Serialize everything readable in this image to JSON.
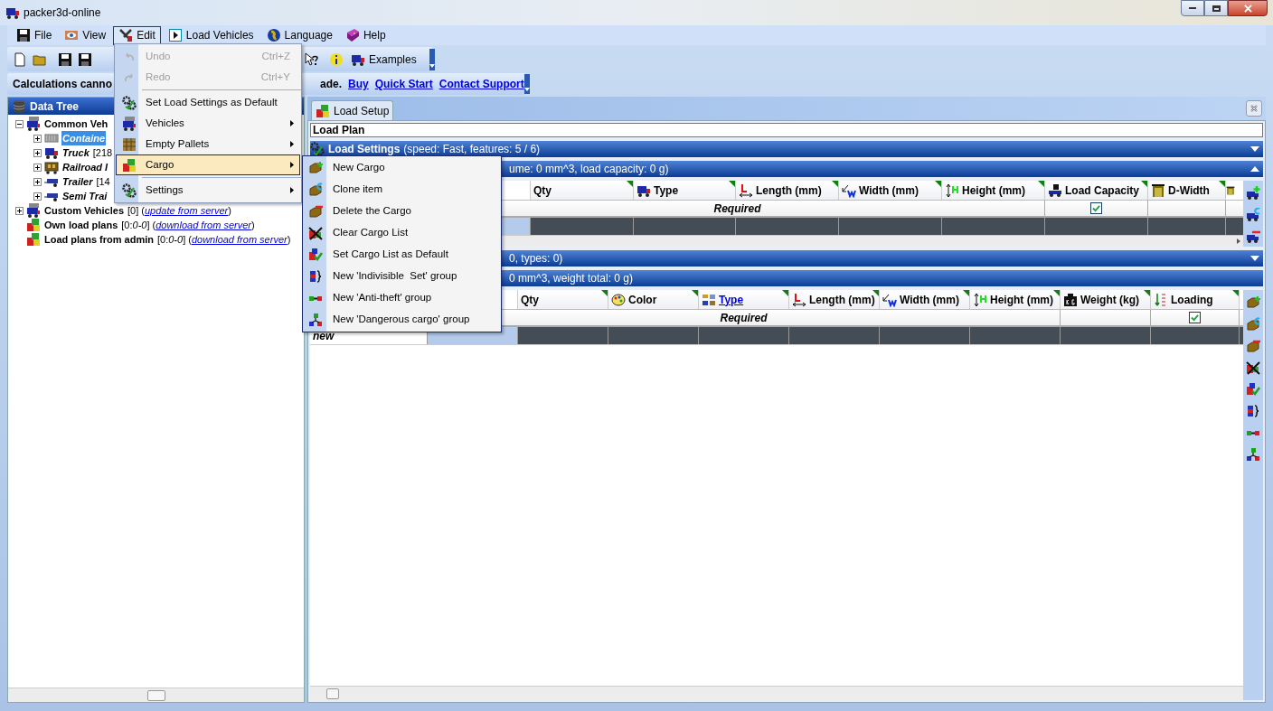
{
  "window": {
    "title": "packer3d-online"
  },
  "menu_bar": [
    {
      "label": "File",
      "selected": false
    },
    {
      "label": "View",
      "selected": false
    },
    {
      "label": "Edit",
      "selected": true
    },
    {
      "label": "Load Vehicles",
      "selected": false
    },
    {
      "label": "Language",
      "selected": false
    },
    {
      "label": "Help",
      "selected": false
    }
  ],
  "toolbar": {
    "examples": "Examples"
  },
  "notice_bar": {
    "text_start": "Calculations canno",
    "text_end": "ade.",
    "links": [
      "Buy",
      "Quick Start",
      "Contact Support"
    ]
  },
  "data_tree": {
    "title": "Data Tree",
    "items": [
      {
        "label": "Common Veh",
        "expanded": true,
        "selected": false,
        "children": [
          {
            "label": "Containe",
            "expanded": false,
            "selected": true
          },
          {
            "label": "Truck",
            "count": "[218",
            "expanded": false,
            "selected": false
          },
          {
            "label": "Railroad I",
            "expanded": false,
            "selected": false
          },
          {
            "label": "Trailer",
            "count": "[14",
            "expanded": false,
            "selected": false
          },
          {
            "label": "Semi Trai",
            "expanded": false,
            "selected": false
          }
        ]
      },
      {
        "label": "Custom Vehicles",
        "count": "[0]",
        "paren_open": "(",
        "link": "update from server",
        "paren_close": ")",
        "expanded": false,
        "selected": false
      },
      {
        "label": "Own load plans",
        "count": "[0:*0-0*]",
        "paren_open": "(",
        "link": "download from server",
        "paren_close": ")",
        "selected": false
      },
      {
        "label": "Load plans from admin",
        "count": "[0:*0-0*]",
        "paren_open": "(",
        "link": "download from server",
        "paren_close": ")",
        "selected": false
      }
    ]
  },
  "tab": {
    "label": "Load Setup",
    "selected": true
  },
  "plan_name": {
    "value": "Load Plan"
  },
  "vehicle_sections": [
    {
      "title": "Load Settings",
      "details": "(speed: Fast, features: 5 / 6)",
      "expanded": false
    },
    {
      "details": "ume: 0 mm^3, load capacity: 0 g)",
      "expanded": true
    }
  ],
  "vehicle_grid": {
    "required_label": "Required",
    "columns": [
      {
        "label": "Qty"
      },
      {
        "label": "Type"
      },
      {
        "label": "Length (mm)"
      },
      {
        "label": "Width (mm)"
      },
      {
        "label": "Height (mm)"
      },
      {
        "label": "Load Capacity",
        "checked": true
      },
      {
        "label": "D-Width"
      }
    ]
  },
  "cargo_sections": [
    {
      "details": "0, types: 0)",
      "expanded": false
    },
    {
      "details": "0 mm^3, weight total: 0 g)"
    }
  ],
  "cargo_grid": {
    "required_label": "Required",
    "new_row_label": "new",
    "columns": [
      {
        "label": "Qty"
      },
      {
        "label": "Color"
      },
      {
        "label": "Type",
        "link": true
      },
      {
        "label": "Length (mm)"
      },
      {
        "label": "Width (mm)"
      },
      {
        "label": "Height (mm)"
      },
      {
        "label": "Weight (kg)"
      },
      {
        "label": "Loading",
        "checked": true
      }
    ]
  },
  "edit_menu": [
    {
      "kind": "item",
      "label": "Undo",
      "shortcut": "Ctrl+Z",
      "disabled": true,
      "selected": false
    },
    {
      "kind": "item",
      "label": "Redo",
      "shortcut": "Ctrl+Y",
      "disabled": true,
      "selected": false
    },
    {
      "kind": "separator"
    },
    {
      "kind": "item",
      "label": "Set Load Settings as Default",
      "disabled": false,
      "selected": false
    },
    {
      "kind": "submenu",
      "label": "Vehicles",
      "disabled": false,
      "selected": false
    },
    {
      "kind": "submenu",
      "label": "Empty Pallets",
      "disabled": false,
      "selected": false
    },
    {
      "kind": "submenu",
      "label": "Cargo",
      "disabled": false,
      "selected": true
    },
    {
      "kind": "separator"
    },
    {
      "kind": "submenu",
      "label": "Settings",
      "disabled": false,
      "selected": false
    }
  ],
  "cargo_menu": [
    {
      "label": "New Cargo"
    },
    {
      "label": "Clone item"
    },
    {
      "label": "Delete the Cargo"
    },
    {
      "label": "Clear Cargo List"
    },
    {
      "label": "Set Cargo List as Default"
    },
    {
      "label": "New 'Indivisible  Set' group"
    },
    {
      "label": "New 'Anti-theft' group"
    },
    {
      "label": "New 'Dangerous cargo' group"
    }
  ]
}
